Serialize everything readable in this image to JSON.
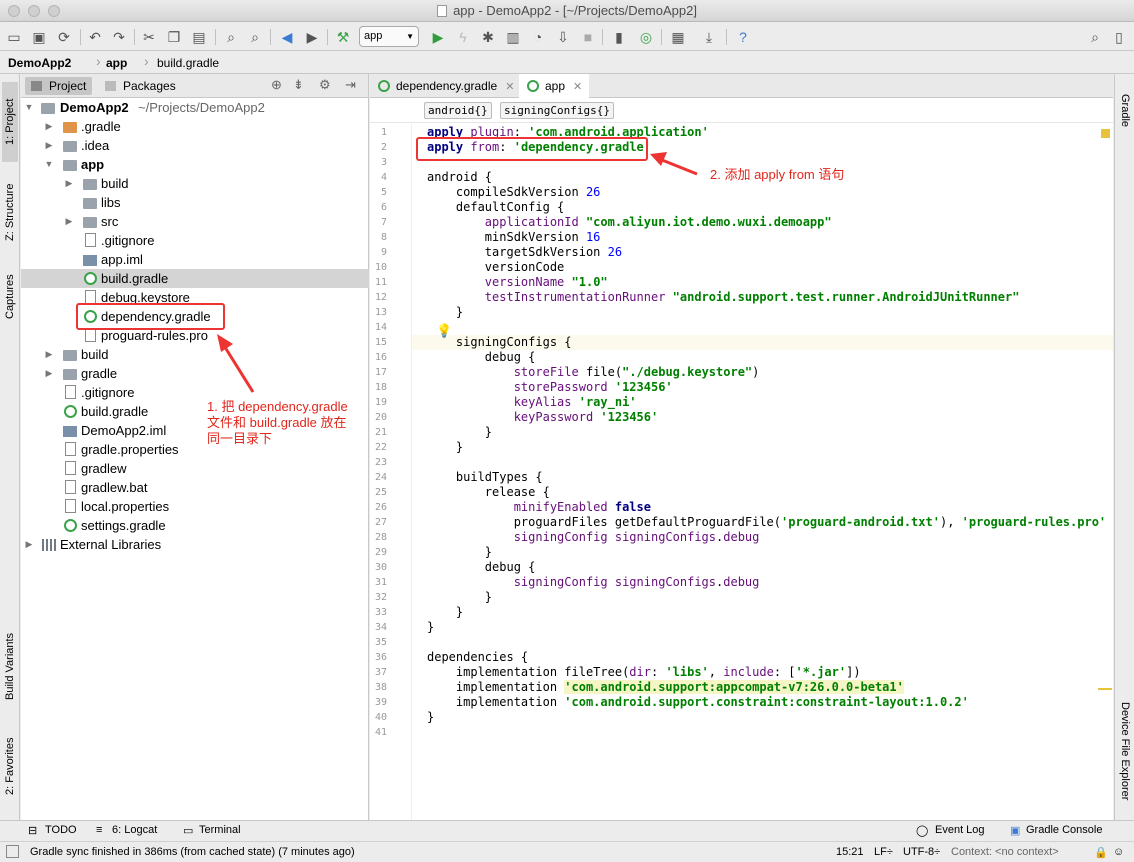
{
  "window": {
    "title": "app - DemoApp2 - [~/Projects/DemoApp2]"
  },
  "toolbar": {
    "run_config": "app"
  },
  "navbar": {
    "crumbs": [
      "DemoApp2",
      "app",
      "build.gradle"
    ]
  },
  "left_stripe": {
    "project": "1: Project",
    "structure": "Z: Structure",
    "captures": "Captures",
    "build_variants": "Build Variants",
    "favorites": "2: Favorites"
  },
  "right_stripe": {
    "gradle": "Gradle",
    "device_explorer": "Device File Explorer"
  },
  "project_panel": {
    "tabs": [
      "Project",
      "Packages"
    ],
    "tree": [
      {
        "label": "DemoApp2",
        "extra": "~/Projects/DemoApp2"
      },
      {
        "label": ".gradle"
      },
      {
        "label": ".idea"
      },
      {
        "label": "app"
      },
      {
        "label": "build"
      },
      {
        "label": "libs"
      },
      {
        "label": "src"
      },
      {
        "label": ".gitignore"
      },
      {
        "label": "app.iml"
      },
      {
        "label": "build.gradle"
      },
      {
        "label": "debug.keystore"
      },
      {
        "label": "dependency.gradle"
      },
      {
        "label": "proguard-rules.pro"
      },
      {
        "label": "build"
      },
      {
        "label": "gradle"
      },
      {
        "label": ".gitignore"
      },
      {
        "label": "build.gradle"
      },
      {
        "label": "DemoApp2.iml"
      },
      {
        "label": "gradle.properties"
      },
      {
        "label": "gradlew"
      },
      {
        "label": "gradlew.bat"
      },
      {
        "label": "local.properties"
      },
      {
        "label": "settings.gradle"
      },
      {
        "label": "External Libraries"
      }
    ]
  },
  "editor": {
    "tabs": [
      "dependency.gradle",
      "app"
    ],
    "breadcrumbs": [
      "android{}",
      "signingConfigs{}"
    ],
    "line_numbers": [
      "1",
      "2",
      "3",
      "4",
      "5",
      "6",
      "7",
      "8",
      "9",
      "10",
      "11",
      "12",
      "13",
      "14",
      "15",
      "16",
      "17",
      "18",
      "19",
      "20",
      "21",
      "22",
      "23",
      "24",
      "25",
      "26",
      "27",
      "28",
      "29",
      "30",
      "31",
      "32",
      "33",
      "34",
      "35",
      "36",
      "37",
      "38",
      "39",
      "40",
      "41"
    ]
  },
  "annotations": {
    "note1_line1": "1. 把 dependency.gradle",
    "note1_line2": "文件和 build.gradle 放在",
    "note1_line3": "同一目录下",
    "note2": "2. 添加 apply from 语句"
  },
  "bottom_tools": {
    "todo": "TODO",
    "logcat": "6: Logcat",
    "terminal": "Terminal",
    "event_log": "Event Log",
    "gradle_console": "Gradle Console"
  },
  "status": {
    "message": "Gradle sync finished in 386ms (from cached state) (7 minutes ago)",
    "position": "15:21",
    "line_sep": "LF÷",
    "encoding": "UTF-8÷",
    "context": "Context: <no context>"
  },
  "colors": {
    "annotation_red": "#e1261c",
    "string_green": "#008000",
    "keyword_navy": "#000080",
    "property_purple": "#660e7a"
  }
}
